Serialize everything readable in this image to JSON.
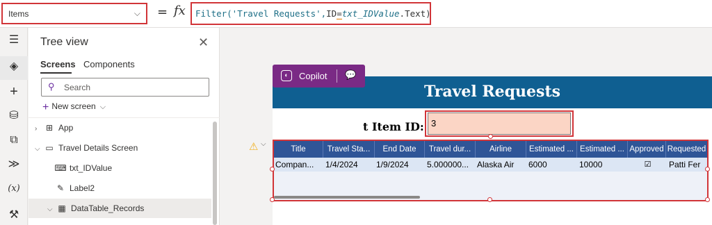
{
  "formula_bar": {
    "property": "Items",
    "equals": "=",
    "fx": "fx",
    "formula": {
      "part1": "Filter('Travel Requests',",
      "part2": "ID",
      "part3": "=",
      "part4": "txt_IDValue",
      "part5": ".Text)"
    }
  },
  "tree_view": {
    "title": "Tree view",
    "tabs": {
      "screens": "Screens",
      "components": "Components"
    },
    "search_placeholder": "Search",
    "new_screen": "New screen",
    "nodes": {
      "app": "App",
      "screen": "Travel Details Screen",
      "txt_idvalue": "txt_IDValue",
      "label2": "Label2",
      "datatable": "DataTable_Records"
    }
  },
  "canvas": {
    "screen_title": "Travel Requests",
    "id_label": "t Item ID:",
    "id_value": "3",
    "copilot": {
      "label": "Copilot"
    },
    "table": {
      "columns": [
        "Title",
        "Travel Sta...",
        "End Date",
        "Travel dur...",
        "Airline",
        "Estimated ...",
        "Estimated ...",
        "Approved",
        "Requested"
      ],
      "row": [
        "Compan...",
        "1/4/2024",
        "1/9/2024",
        "5.000000...",
        "Alaska Air",
        "6000",
        "10000",
        "☑",
        "Patti Fer"
      ]
    }
  },
  "colors": {
    "accent_red": "#d13438",
    "header_blue": "#0f5f91",
    "grid_header": "#2f5597",
    "copilot_purple": "#7a2a85"
  }
}
